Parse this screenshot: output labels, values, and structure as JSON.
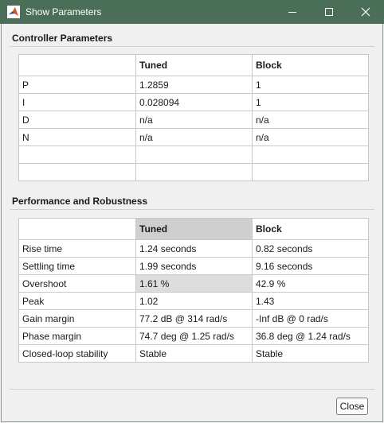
{
  "window": {
    "title": "Show Parameters",
    "icon": "matlab-icon",
    "controls": [
      "minimize-icon",
      "maximize-icon",
      "close-icon"
    ]
  },
  "controller": {
    "heading": "Controller Parameters",
    "columns": [
      "",
      "Tuned",
      "Block"
    ],
    "rows": [
      [
        "P",
        "1.2859",
        "1"
      ],
      [
        "I",
        "0.028094",
        "1"
      ],
      [
        "D",
        "n/a",
        "n/a"
      ],
      [
        "N",
        "n/a",
        "n/a"
      ],
      [
        "",
        "",
        ""
      ],
      [
        "",
        "",
        ""
      ]
    ]
  },
  "performance": {
    "heading": "Performance and Robustness",
    "columns": [
      "",
      "Tuned",
      "Block"
    ],
    "rows": [
      [
        "Rise time",
        "1.24 seconds",
        "0.82 seconds"
      ],
      [
        "Settling time",
        "1.99 seconds",
        "9.16 seconds"
      ],
      [
        "Overshoot",
        "1.61 %",
        "42.9 %"
      ],
      [
        "Peak",
        "1.02",
        "1.43"
      ],
      [
        "Gain margin",
        "77.2 dB @ 314 rad/s",
        "-Inf dB @ 0 rad/s"
      ],
      [
        "Phase margin",
        "74.7 deg @ 1.25 rad/s",
        "36.8 deg @ 1.24 rad/s"
      ],
      [
        "Closed-loop stability",
        "Stable",
        "Stable"
      ]
    ]
  },
  "buttons": {
    "close_label": "Close"
  },
  "colors": {
    "titlebar": "#4a6e58",
    "highlight_cell": "#dcdcdc"
  }
}
